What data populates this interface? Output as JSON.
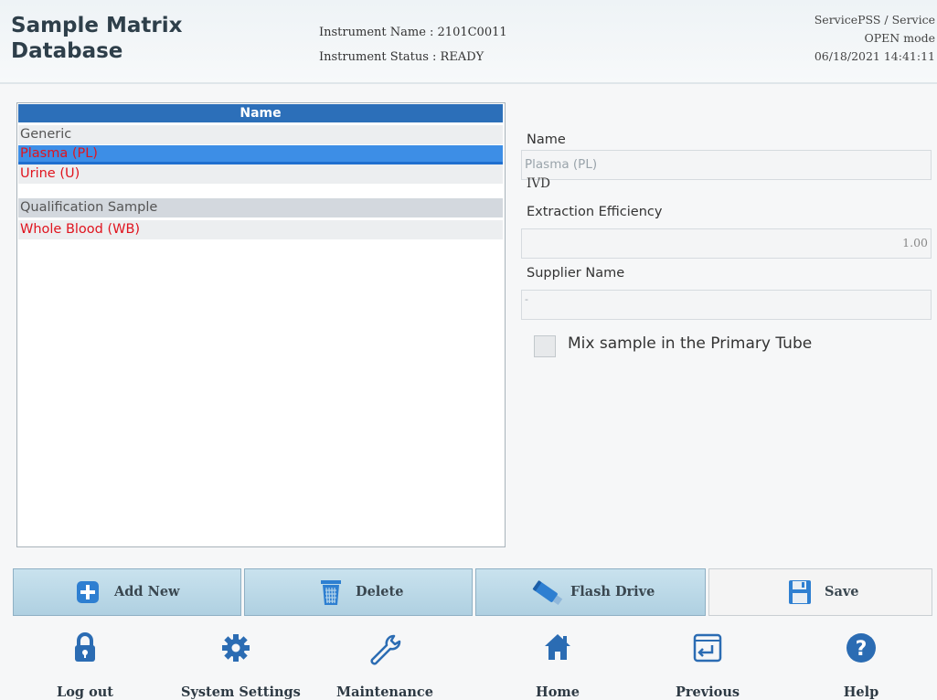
{
  "header": {
    "title_line1": "Sample Matrix",
    "title_line2": "Database",
    "instrument_name": "Instrument Name : 2101C0011",
    "instrument_status": "Instrument Status : READY",
    "user": "ServicePSS / Service",
    "mode": "OPEN mode",
    "datetime": "06/18/2021 14:41:11"
  },
  "list": {
    "header": "Name",
    "items": [
      {
        "label": "Generic",
        "color": "#555555"
      },
      {
        "label": "Plasma (PL)",
        "color": "#e0141e",
        "selected": true
      },
      {
        "label": "Urine (U)",
        "color": "#e0141e"
      },
      {
        "label": "Qualification Sample",
        "color": "#555555"
      },
      {
        "label": "Whole Blood (WB)",
        "color": "#e0141e"
      }
    ]
  },
  "detail": {
    "name_label": "Name",
    "name_value": "Plasma (PL)",
    "ivd_label": "IVD",
    "extraction_label": "Extraction Efficiency",
    "extraction_value": "1.00",
    "supplier_label": "Supplier Name",
    "supplier_value": "-",
    "mix_label": "Mix sample in the Primary Tube",
    "mix_checked": false
  },
  "actions": {
    "add_new": "Add New",
    "delete": "Delete",
    "flash_drive": "Flash Drive",
    "save": "Save"
  },
  "nav": {
    "logout": "Log out",
    "system_settings": "System Settings",
    "maintenance": "Maintenance",
    "home": "Home",
    "previous": "Previous",
    "help": "Help"
  },
  "colors": {
    "list_header": "#2c6fb9",
    "selected_row": "#3d8ee6",
    "contaminated_text": "#e0141e",
    "button_bg": "#c9e2ee"
  }
}
